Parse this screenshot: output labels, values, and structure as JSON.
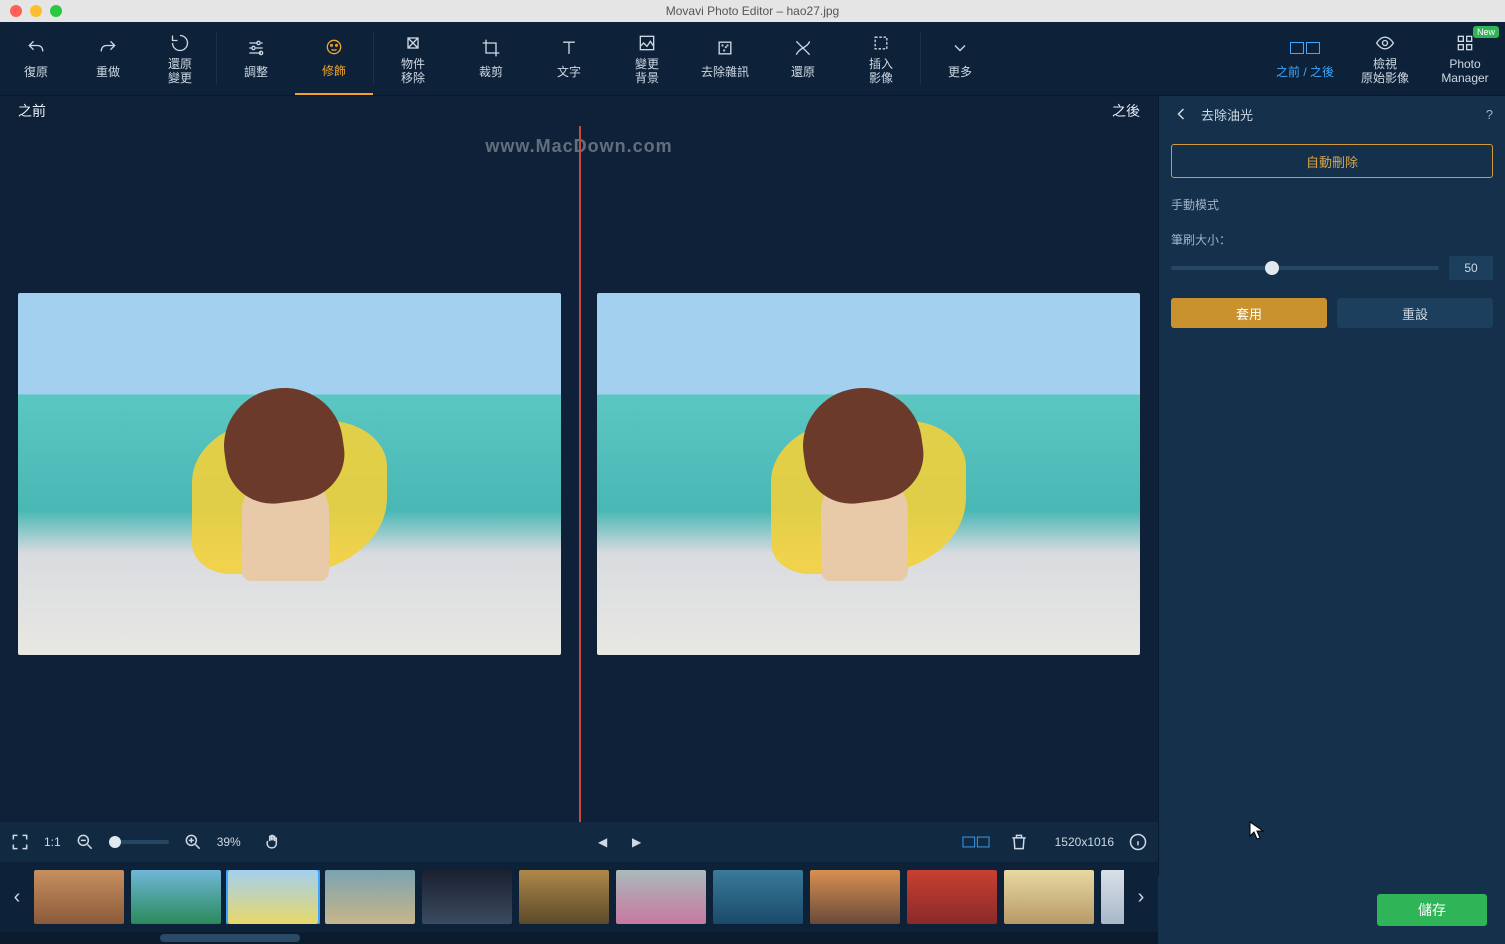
{
  "window": {
    "title": "Movavi Photo Editor – hao27.jpg"
  },
  "watermark": "www.MacDown.com",
  "toolbar": {
    "undo": "復原",
    "redo": "重做",
    "revert": "還原\n變更",
    "adjust": "調整",
    "retouch": "修飾",
    "object_removal": "物件\n移除",
    "crop": "裁剪",
    "text": "文字",
    "change_bg": "變更\n背景",
    "denoise": "去除雜訊",
    "restore": "還原",
    "insert_image": "插入\n影像",
    "more": "更多",
    "before_after": "之前 / 之後",
    "view_original": "檢視\n原始影像",
    "photo_manager": "Photo\nManager",
    "new_badge": "New"
  },
  "canvas": {
    "before": "之前",
    "after": "之後"
  },
  "panel": {
    "title": "去除油光",
    "auto_remove": "自動刪除",
    "manual_mode": "手動模式",
    "brush_size_label": "筆刷大小：",
    "brush_size_value": "50",
    "apply": "套用",
    "reset": "重設"
  },
  "bottom": {
    "fit": "1:1",
    "zoom_percent": "39%",
    "dimensions": "1520x1016"
  },
  "save": {
    "label": "儲存"
  },
  "thumbnails": [
    {
      "bg": "linear-gradient(#c89060,#8a5a3a)"
    },
    {
      "bg": "linear-gradient(#6fb7d8,#2a8a5a)"
    },
    {
      "bg": "linear-gradient(#a3d0ef,#e8d86a)",
      "selected": true
    },
    {
      "bg": "linear-gradient(#7aa3b0,#c8b68a)"
    },
    {
      "bg": "linear-gradient(#1a2030,#3a4a60)"
    },
    {
      "bg": "linear-gradient(#b0884a,#5a4a2a)"
    },
    {
      "bg": "linear-gradient(#a9babb,#c878a0)"
    },
    {
      "bg": "linear-gradient(#3a7a9a,#1a4a6a)"
    },
    {
      "bg": "linear-gradient(#d89050,#6a4a3a)"
    },
    {
      "bg": "linear-gradient(#c84030,#8a2a2a)"
    },
    {
      "bg": "linear-gradient(#e8d8a0,#b89a6a)"
    },
    {
      "bg": "linear-gradient(#d8e0e8,#a8b8c8)"
    }
  ]
}
